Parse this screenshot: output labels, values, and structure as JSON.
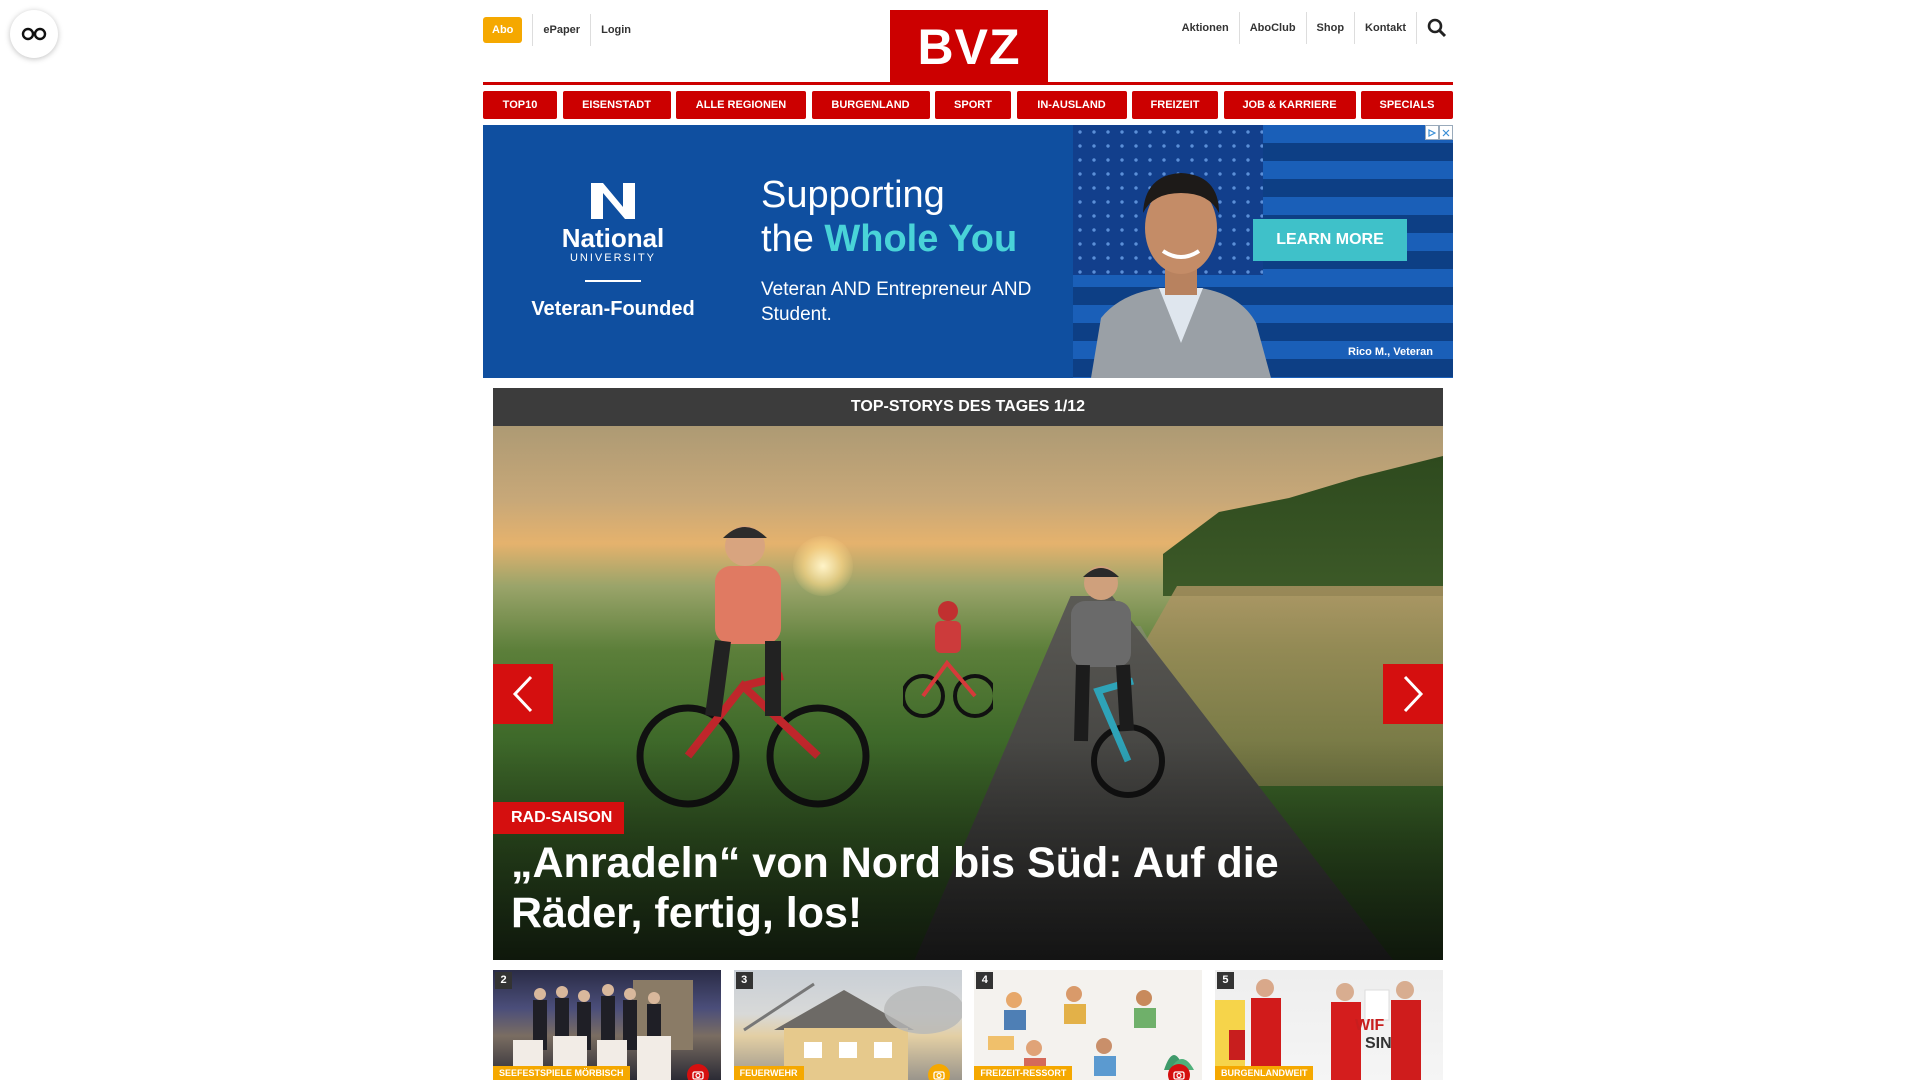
{
  "header": {
    "abo_label": "Abo",
    "left_links": [
      "ePaper",
      "Login"
    ],
    "logo_text": "BVZ",
    "right_links": [
      "Aktionen",
      "AboClub",
      "Shop",
      "Kontakt"
    ],
    "search_icon": "search-icon",
    "reader_icon": "glasses-icon"
  },
  "nav": [
    "TOP10",
    "EISENSTADT",
    "ALLE REGIONEN",
    "BURGENLAND",
    "SPORT",
    "IN-AUSLAND",
    "FREIZEIT",
    "JOB & KARRIERE",
    "SPECIALS"
  ],
  "ad": {
    "brand_name": "National",
    "brand_sub": "UNIVERSITY",
    "tagline": "Veteran-Founded",
    "headline_line1": "Supporting",
    "headline_the": "the ",
    "headline_accent": "Whole You",
    "subline": "Veteran AND Entrepreneur AND Student.",
    "cta": "LEARN MORE",
    "caption": "Rico M., Veteran",
    "colors": {
      "background": "#0f4fa0",
      "accent": "#49d3d8",
      "cta": "#3fc1c9"
    }
  },
  "stories": {
    "heading": "TOP-STORYS DES TAGES 1/12",
    "hero_tag": "RAD-SAISON",
    "hero_title": "„Anradeln“ von Nord bis Süd: Auf die Räder, fertig, los!",
    "thumbs": [
      {
        "num": "2",
        "label": "SEEFESTSPIELE MÖRBISCH",
        "icon": "camera-icon"
      },
      {
        "num": "3",
        "label": "FEUERWEHR",
        "icon": "camera-icon"
      },
      {
        "num": "4",
        "label": "FREIZEIT-RESSORT",
        "icon": "camera-icon"
      },
      {
        "num": "5",
        "label": "BURGENLANDWEIT",
        "icon": ""
      }
    ]
  },
  "colors": {
    "brand_red": "#cc0000",
    "abo_yellow": "#f5a800",
    "story_header": "#3c3c3c"
  }
}
